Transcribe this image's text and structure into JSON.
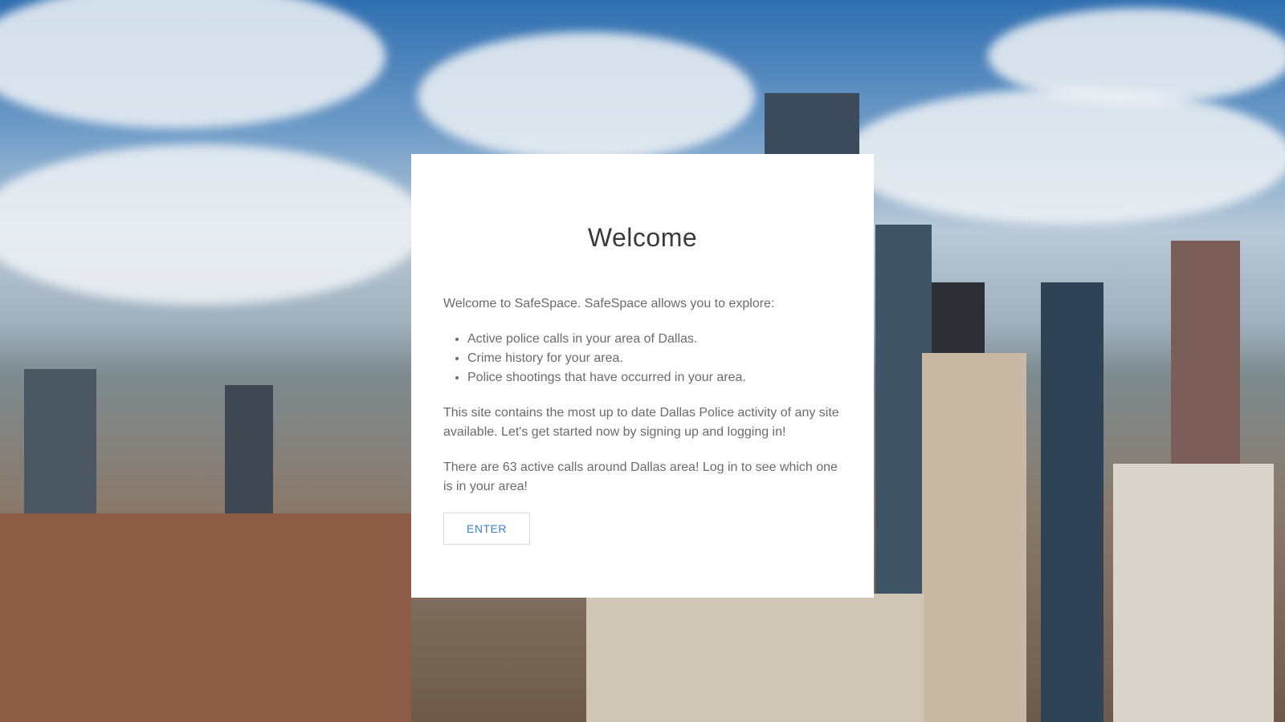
{
  "modal": {
    "title": "Welcome",
    "intro": "Welcome to SafeSpace. SafeSpace allows you to explore:",
    "features": [
      "Active police calls in your area of Dallas.",
      "Crime history for your area.",
      "Police shootings that have occurred in your area."
    ],
    "paragraph_activity": "This site contains the most up to date Dallas Police activity of any site available. Let's get started now by signing up and logging in!",
    "paragraph_calls": "There are 63 active calls around Dallas area! Log in to see which one is in your area!",
    "enter_label": "ENTER"
  },
  "colors": {
    "accent": "#3d7fcc",
    "title": "#3a3a3a",
    "body_text": "#6b6b6b"
  }
}
